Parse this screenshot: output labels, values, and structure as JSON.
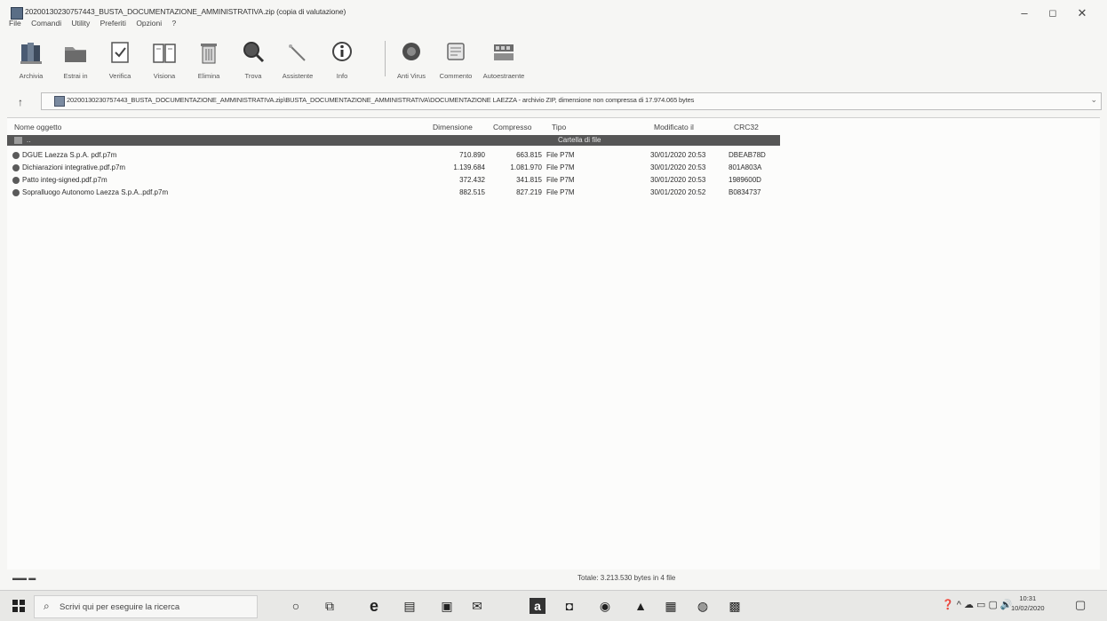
{
  "window": {
    "title": "20200130230757443_BUSTA_DOCUMENTAZIONE_AMMINISTRATIVA.zip (copia di valutazione)",
    "controls": {
      "minimize": "–",
      "maximize": "◻",
      "close": "✕"
    }
  },
  "menu": [
    "File",
    "Comandi",
    "Utility",
    "Preferiti",
    "Opzioni",
    "?"
  ],
  "toolbar": {
    "buttons": [
      {
        "label": "Archivia",
        "icon": "archive-books-icon"
      },
      {
        "label": "Estrai in",
        "icon": "folder-extract-icon"
      },
      {
        "label": "Verifica",
        "icon": "verify-icon"
      },
      {
        "label": "Visiona",
        "icon": "book-view-icon"
      },
      {
        "label": "Elimina",
        "icon": "trash-bin-icon"
      },
      {
        "label": "Trova",
        "icon": "magnifier-icon"
      },
      {
        "label": "Assistente",
        "icon": "wizard-wand-icon"
      },
      {
        "label": "Info",
        "icon": "info-icon"
      },
      {
        "label": "Anti Virus",
        "icon": "antivirus-icon"
      },
      {
        "label": "Commento",
        "icon": "comment-icon"
      },
      {
        "label": "Autoestraente",
        "icon": "sfx-icon"
      }
    ]
  },
  "address": {
    "up_arrow": "↑",
    "path": "20200130230757443_BUSTA_DOCUMENTAZIONE_AMMINISTRATIVA.zip\\BUSTA_DOCUMENTAZIONE_AMMINISTRATIVA\\DOCUMENTAZIONE LAEZZA - archivio ZIP, dimensione non compressa di 17.974.065 bytes",
    "dropdown": "⌄"
  },
  "filelist": {
    "headers": {
      "name": "Nome oggetto",
      "size": "Dimensione",
      "packed": "Compresso",
      "type": "Tipo",
      "modified": "Modificato il",
      "crc": "CRC32"
    },
    "folder_row": {
      "name": "..",
      "type": "Cartella di file"
    },
    "rows": [
      {
        "name": "DGUE Laezza S.p.A. pdf.p7m",
        "size": "710.890",
        "packed": "663.815",
        "type": "File P7M",
        "modified": "30/01/2020 20:53",
        "crc": "DBEAB78D"
      },
      {
        "name": "Dichiarazioni integrative.pdf.p7m",
        "size": "1.139.684",
        "packed": "1.081.970",
        "type": "File P7M",
        "modified": "30/01/2020 20:53",
        "crc": "801A803A"
      },
      {
        "name": "Patto integ-signed.pdf.p7m",
        "size": "372.432",
        "packed": "341.815",
        "type": "File P7M",
        "modified": "30/01/2020 20:53",
        "crc": "1989600D"
      },
      {
        "name": "Sopralluogo Autonomo Laezza S.p.A..pdf.p7m",
        "size": "882.515",
        "packed": "827.219",
        "type": "File P7M",
        "modified": "30/01/2020 20:52",
        "crc": "B0834737"
      }
    ]
  },
  "status": {
    "left": "▬▬ ▬",
    "center": "Totale: 3.213.530 bytes in 4 file"
  },
  "taskbar": {
    "search_placeholder": "Scrivi qui per eseguire la ricerca",
    "search_glyph": "⌕",
    "apps": [
      {
        "glyph": "○",
        "icon": "cortana-icon"
      },
      {
        "glyph": "⧉",
        "icon": "task-view-icon"
      },
      {
        "glyph": "e",
        "icon": "edge-icon"
      },
      {
        "glyph": "▤",
        "icon": "file-explorer-icon"
      },
      {
        "glyph": "▣",
        "icon": "store-icon"
      },
      {
        "glyph": "✉",
        "icon": "mail-icon"
      },
      {
        "glyph": "a",
        "icon": "amazon-icon"
      },
      {
        "glyph": "◘",
        "icon": "office-icon"
      },
      {
        "glyph": "◉",
        "icon": "chrome-icon"
      },
      {
        "glyph": "▲",
        "icon": "drive-icon"
      },
      {
        "glyph": "▦",
        "icon": "app-icon"
      },
      {
        "glyph": "◍",
        "icon": "browser-icon"
      },
      {
        "glyph": "▩",
        "icon": "winrar-icon"
      }
    ],
    "tray_icons": "❓ ^ ☁ ▭ ▢ 🔊",
    "time": "10:31",
    "date": "10/02/2020",
    "notification": "▢"
  }
}
